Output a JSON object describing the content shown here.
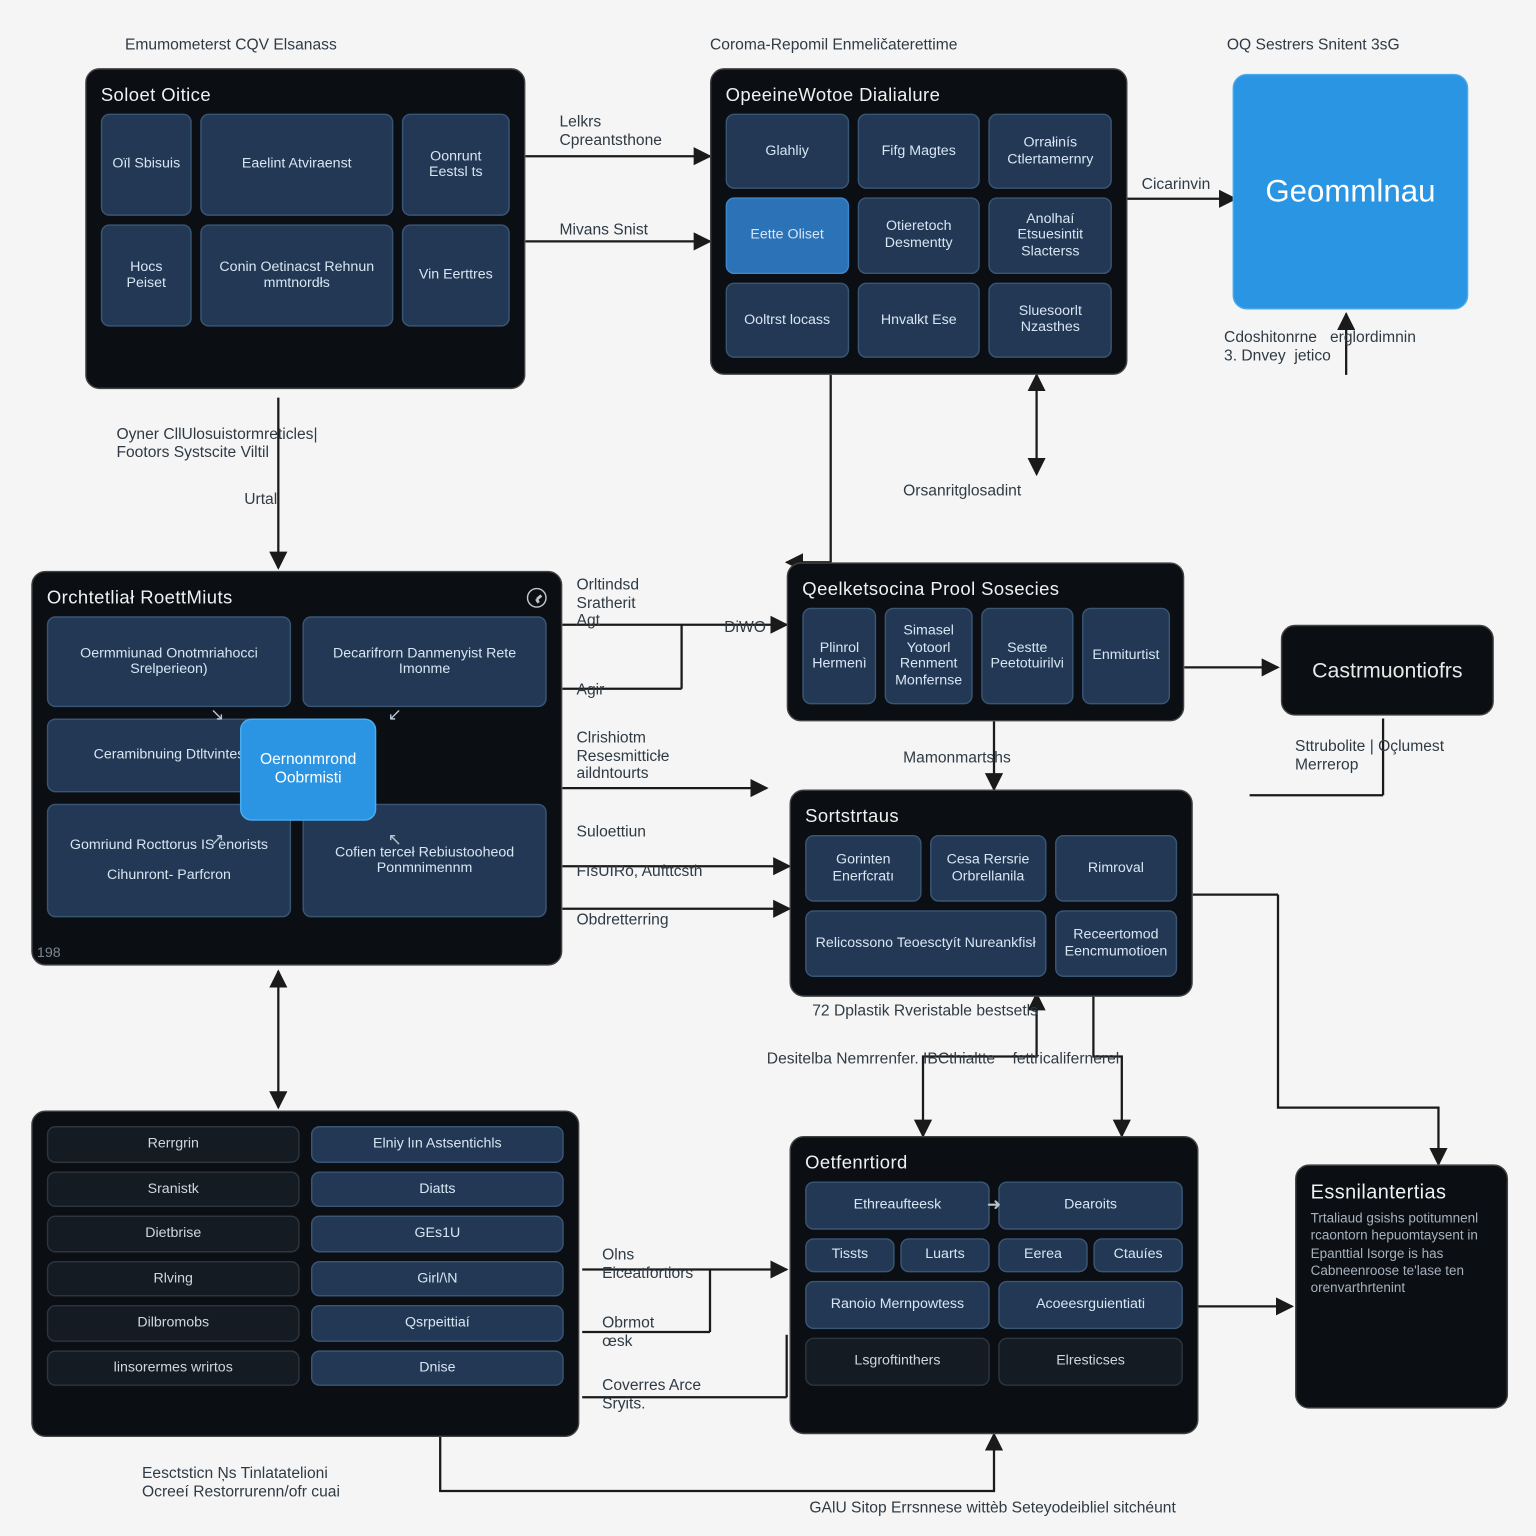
{
  "headers": {
    "h1": "Emumometerst CQV Elsanass",
    "h2": "Coroma-Repomil Enmeličaterettime",
    "h3": "OQ Sestrers Snitent 3sG"
  },
  "soloet": {
    "title": "Soloet Oitice",
    "cells": [
      "Oïl Sbisuis",
      "Eaelint Atviraenst",
      "Oonrunt Eestsl ts",
      "Hocs Peiset",
      "Conin Oetinacst Rehnun mmtnordłs",
      "Vin Eerttres"
    ]
  },
  "opeen": {
    "title": "OpeeineWotoe Dialialure",
    "cells": [
      "Glahliy",
      "Fifg Magtes",
      "Orrałinís Ctlertamernry",
      "Eette Oliset",
      "Otieretoch Desmentty",
      "Anolhaí Etsuesintit Slacterss",
      "Ooltrst locass",
      "Hnvalkt Ese",
      "Sluesoorlt Nzasthes"
    ]
  },
  "gem": {
    "title": "Geommlnau"
  },
  "orch": {
    "title": "Orchtetliał RoettMiuts",
    "cells": {
      "tl": "Oermmiunad Onotmriahocci Srelperieon)",
      "tr": "Decarifrorn Danmenyist Rete Imonme",
      "ml": "Ceramibnuing Dtltvintes",
      "bl": "Gomriund Rocttorus IS enorists",
      "blc": "Cihunront- Parfcron",
      "br": "Cofien terceł Rebiustooheod Ponmnimennm",
      "center": "Oernonmrond\nOobrmisti"
    },
    "badge": "198"
  },
  "qp": {
    "title": "Qeelketsocina Prool Sosecies",
    "cells": [
      "Plinrol Hermenì",
      "Simasel Yotoorl Renment Monfernse",
      "Sestte Peetotuirilvi",
      "Enmiturtist"
    ]
  },
  "sr": {
    "title": "Sortstrtaus",
    "cells": [
      "Gorinten Enerfcratı",
      "Cesa Rersrie Orbrellanila",
      "Rimroval",
      "Relicossono Teoesctyít Nureankfisł",
      "Receertomod Eencmumotioen"
    ],
    "footer": "72 Dplastik Rveristable bestsetls"
  },
  "leftlist": {
    "colA": [
      "Rerrgrin",
      "Sranistk",
      "Dietbrise",
      "Rlving",
      "Dilbromobs",
      "linsorermes wrirtos"
    ],
    "colB": [
      "Elniy lın Astsentichls",
      "Diatts",
      "GEs1U",
      "Girl/\\N",
      "Qsrpeittiaí",
      "Dnise"
    ]
  },
  "oet": {
    "title": "Oetfenrtiord",
    "cells": [
      "Ethreaufteesk",
      "Dearoits",
      "Tissts",
      "Luarts",
      "Eerea",
      "Ctauíes",
      "Ranoio Mernpowtess",
      "Acoeesrguientiati",
      "Lsgroftinthers",
      "Elresticses"
    ]
  },
  "cas": {
    "title": "Castrmuontiofrs"
  },
  "ess": {
    "title": "Essnilantertias",
    "body": "Trtaliaud gsishs potitumnenl rcaontorn hepuomtaysent in Epanttial Isorge is has Cabneenroose te'lase ten orenvarthrtenint"
  },
  "labels": {
    "l1": "Lelkrs\nCpreantsthone",
    "l2": "Mivans Snist",
    "l3": "Cicarinvin",
    "l4": "Cdoshitonrne   erglordimnin\n3. Dnvey  jetico",
    "l5": "Oyner CllUlosuistormreticles|\nFootors Systscite Viltil",
    "l6": "Urtal",
    "l7": "Orltindsd\nSratherit\nAgt",
    "l8": "DiWO",
    "l9": "Agir",
    "l10": "Clrishiotm\nResesmitticłe\naildntourts",
    "l11": "Suloettiun",
    "l12": "FIsUIRo, Aufttcsth",
    "l13": "Obdretterring",
    "l14": "Mamonmartshs",
    "l15": "Orsanritglosadint",
    "l16": "Sttrubolite | Oçlumest\nMerrerop",
    "l17": "Desitelba Nemrrenfer. IBCthialtte    fettricalifernerel",
    "l18": "Olns\nEiceatfortiors",
    "l19": "Obrmot   \nœsk",
    "l20": "Coverres Arce\nSryits.",
    "l21": "Eesctsticn Ņs Tinlatatelioni\nOcreeí Restorrurenn/ofr cuai",
    "l22": "GAlU Sitop Errsnnese wittèb Seteyodeibliel sitchéunt"
  }
}
